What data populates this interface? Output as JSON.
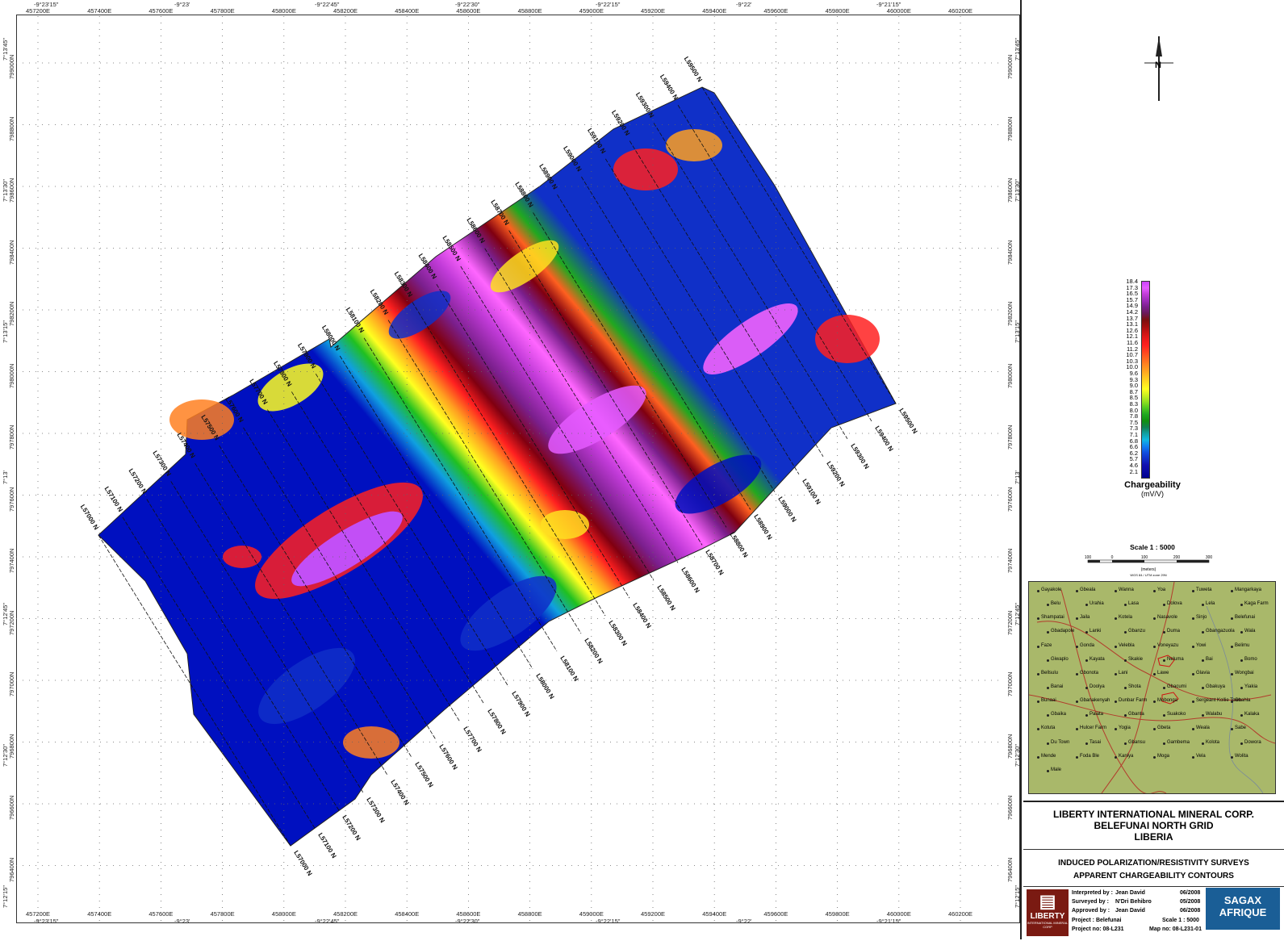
{
  "map": {
    "easting_ticks_top": [
      "457200E",
      "457400E",
      "457600E",
      "457800E",
      "458000E",
      "458200E",
      "458400E",
      "458600E",
      "458800E",
      "459000E",
      "459200E",
      "459400E",
      "459600E",
      "459800E",
      "460000E",
      "460200E"
    ],
    "easting_ticks_bottom": [
      "457200E",
      "457400E",
      "457600E",
      "457800E",
      "458000E",
      "458200E",
      "458400E",
      "458600E",
      "458800E",
      "459000E",
      "459200E",
      "459400E",
      "459600E",
      "459800E",
      "460000E",
      "460200E"
    ],
    "longitude_ticks_top": [
      "-9°23'15\"",
      "-9°23'",
      "-9°22'45\"",
      "-9°22'30\"",
      "-9°22'15\"",
      "-9°22'",
      "-9°21'15\""
    ],
    "longitude_ticks_bottom": [
      "-9°23'15\"",
      "-9°23'",
      "-9°22'45\"",
      "-9°22'30\"",
      "-9°22'15\"",
      "-9°22'",
      "-9°21'15\""
    ],
    "northing_ticks": [
      "799000N",
      "798800N",
      "798600N",
      "798400N",
      "798200N",
      "798000N",
      "797800N",
      "797600N",
      "797400N",
      "797200N",
      "797000N",
      "796800N",
      "796600N",
      "796400N"
    ],
    "latitude_ticks": [
      "7°13'45\"",
      "7°13'30\"",
      "7°13'15\"",
      "7°13'",
      "7°12'45\"",
      "7°12'30\"",
      "7°12'15\""
    ],
    "line_labels": [
      "L57000 N",
      "L57100 N",
      "L57200 N",
      "L57300 N",
      "L57400 N",
      "L57500 N",
      "L57600 N",
      "L57700 N",
      "L57800 N",
      "L57900 N",
      "L58000 N",
      "L58100 N",
      "L58200 N",
      "L58300 N",
      "L58400 N",
      "L58500 N",
      "L58600 N",
      "L58700 N",
      "L58800 N",
      "L58900 N",
      "L59000 N",
      "L59100 N",
      "L59200 N",
      "L59300 N",
      "L59400 N",
      "L59500 N"
    ]
  },
  "legend": {
    "values": [
      "18.4",
      "17.3",
      "16.5",
      "15.7",
      "14.9",
      "14.2",
      "13.7",
      "13.1",
      "12.6",
      "12.1",
      "11.6",
      "11.2",
      "10.7",
      "10.3",
      "10.0",
      "9.6",
      "9.3",
      "9.0",
      "8.7",
      "8.5",
      "8.3",
      "8.0",
      "7.8",
      "7.5",
      "7.3",
      "7.1",
      "6.8",
      "6.6",
      "6.2",
      "5.7",
      "4.6",
      "2.1"
    ],
    "title": "Chargeability",
    "unit": "(mV/V)",
    "colors": [
      "#cc44ff",
      "#e65cff",
      "#c13bd8",
      "#9c2bb8",
      "#7a1f8c",
      "#6a1a5a",
      "#7a1010",
      "#a01010",
      "#c81414",
      "#e81a1a",
      "#ff2020",
      "#ff4020",
      "#ff6020",
      "#ff8020",
      "#ffa020",
      "#ffc020",
      "#ffe020",
      "#ffff20",
      "#c8f020",
      "#90e020",
      "#50c820",
      "#20a820",
      "#109010",
      "#108050",
      "#10a0a0",
      "#10b8e0",
      "#1080f0",
      "#1050e0",
      "#1030c8",
      "#1010b0",
      "#0808a0",
      "#000090"
    ]
  },
  "scale": {
    "title": "Scale 1 : 5000",
    "ticks": [
      "100",
      "0",
      "100",
      "200",
      "300"
    ],
    "unit": "(meters)",
    "datum": "WGS 84 / UTM zone 29N"
  },
  "location_map": {
    "towns": [
      "Gayakole",
      "Gbeala",
      "Wanna",
      "Yoa",
      "Tuweta",
      "Mangarkaya",
      "Belu",
      "Urahia",
      "Lasa",
      "Dolova",
      "Lela",
      "Kaga Farm",
      "Shampatai",
      "Jaila",
      "Kotela",
      "Nasavole",
      "Sinjo",
      "Belefunai",
      "Gbadapole",
      "Lanki",
      "Gbanzu",
      "Duma",
      "Gbangazuola",
      "Wala",
      "Faze",
      "Gonda",
      "Velebla",
      "Voneyazu",
      "Yowi",
      "Belimu",
      "Giwaplo",
      "Kayata",
      "Skakie",
      "Neluma",
      "Bai",
      "Bomo",
      "Bellsulu",
      "Gbonota",
      "Lani",
      "Lawe",
      "Glavia",
      "Wongbai",
      "Banai",
      "Doolya",
      "Shota",
      "Gbacumi",
      "Gbakuya",
      "Yiakia",
      "Bunaai",
      "Gbanakenyah",
      "Dunbar Farm",
      "Mobonga",
      "Sergeant Kollie Town",
      "Gbahla",
      "Gbaika",
      "Paiata",
      "Gbanta",
      "Suakoko",
      "Walabu",
      "Kalaka",
      "Kotuta",
      "Hulcer Farm",
      "Yogia",
      "Gbeta",
      "Weala",
      "Sabe",
      "Du Town",
      "Tasai",
      "Gbansu",
      "Gambema",
      "Kolota",
      "Dowora",
      "Mende",
      "Foda Ble",
      "Kaniya",
      "Moga",
      "Vela",
      "Wolita",
      "Male"
    ]
  },
  "title_block": {
    "company": "LIBERTY INTERNATIONAL MINERAL CORP.",
    "grid": "BELEFUNAI NORTH GRID",
    "country": "LIBERIA",
    "survey": "INDUCED POLARIZATION/RESISTIVITY SURVEYS",
    "product": "APPARENT CHARGEABILITY CONTOURS",
    "interpreted_label": "Interpreted by :",
    "interpreted_name": "Jean David",
    "interpreted_date": "06/2008",
    "surveyed_label": "Surveyed by :",
    "surveyed_name": "N'Dri Behibro",
    "surveyed_date": "05/2008",
    "approved_label": "Approved by :",
    "approved_name": "Jean David",
    "approved_date": "06/2008",
    "project_label": "Project : Belefunai",
    "scale_label": "Scale 1 : 5000",
    "project_no": "Project no: 08-L231",
    "map_no": "Map no: 08-L231-01",
    "logo_left": "LIBERTY",
    "logo_left_sub": "INTERNATIONAL MINERAL CORP",
    "logo_right_1": "SAGAX",
    "logo_right_2": "AFRIQUE"
  }
}
